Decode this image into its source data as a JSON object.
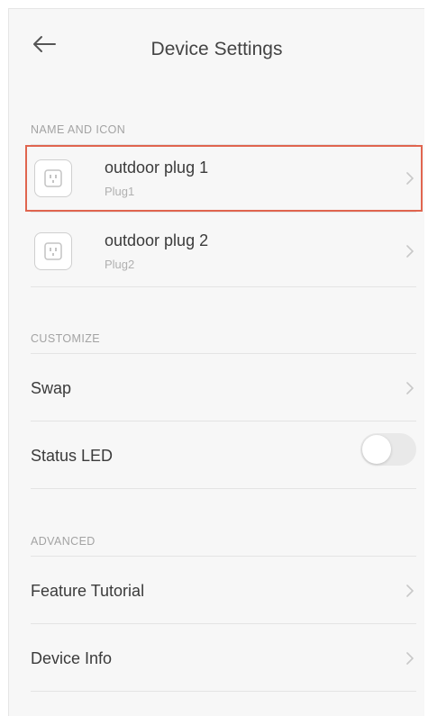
{
  "header": {
    "title": "Device Settings",
    "back_icon": "arrow-left-icon"
  },
  "sections": {
    "name_icon": "NAME AND ICON",
    "customize": "CUSTOMIZE",
    "advanced": "ADVANCED"
  },
  "plugs": [
    {
      "name": "outdoor plug 1",
      "subtitle": "Plug1",
      "icon": "outlet-icon",
      "highlighted": true
    },
    {
      "name": "outdoor plug 2",
      "subtitle": "Plug2",
      "icon": "outlet-icon",
      "highlighted": false
    }
  ],
  "customize": {
    "swap_label": "Swap",
    "status_led_label": "Status LED",
    "status_led_on": false
  },
  "advanced": {
    "feature_tutorial_label": "Feature Tutorial",
    "device_info_label": "Device Info"
  },
  "colors": {
    "highlight": "#e0654f",
    "background": "#f7f7f7",
    "section_text": "#a3a3a3",
    "primary_text": "#3b3b3b"
  }
}
